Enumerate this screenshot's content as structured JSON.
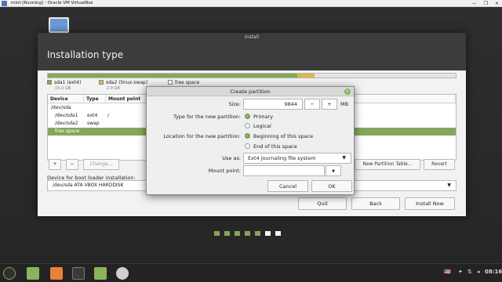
{
  "host_window": {
    "title": "mint [Running] - Oracle VM VirtualBox",
    "controls": [
      "—",
      "❐",
      "✕"
    ]
  },
  "installer": {
    "window_title": "Install",
    "page_title": "Installation type",
    "legend": [
      {
        "name": "sda1 (ext4)",
        "size": "15.0 GB",
        "color": "#85a85b"
      },
      {
        "name": "sda2 (linux-swap)",
        "size": "2.0 GB",
        "color": "#d9b94a"
      },
      {
        "name": "free space",
        "size": "",
        "color": "#ffffff"
      }
    ],
    "table": {
      "headers": [
        "Device",
        "Type",
        "Mount point"
      ],
      "rows": [
        {
          "device": "/dev/sda",
          "type": "",
          "mount": ""
        },
        {
          "device": "/dev/sda1",
          "type": "ext4",
          "mount": "/"
        },
        {
          "device": "/dev/sda2",
          "type": "swap",
          "mount": ""
        },
        {
          "device": "free space",
          "type": "",
          "mount": ""
        }
      ],
      "selected_index": 3
    },
    "toolbar": {
      "add": "+",
      "remove": "−",
      "change": "Change...",
      "new_table": "New Partition Table...",
      "revert": "Revert"
    },
    "boot_label": "Device for boot loader installation:",
    "boot_value": "/dev/sda   ATA VBOX HARDDISK",
    "buttons": {
      "quit": "Quit",
      "back": "Back",
      "install": "Install Now"
    },
    "progress": {
      "total_steps": 7,
      "completed_steps": 5
    }
  },
  "dialog": {
    "title": "Create partition",
    "size_label": "Size:",
    "size_value": "9844",
    "minus": "−",
    "plus": "+",
    "unit": "MB",
    "type_label": "Type for the new partition:",
    "type_options": [
      "Primary",
      "Logical"
    ],
    "type_selected": "Primary",
    "location_label": "Location for the new partition:",
    "location_options": [
      "Beginning of this space",
      "End of this space"
    ],
    "location_selected": "Beginning of this space",
    "use_as_label": "Use as:",
    "use_as_value": "Ext4 journaling file system",
    "mount_label": "Mount point:",
    "mount_value": "",
    "cancel": "Cancel",
    "ok": "OK"
  },
  "taskbar": {
    "lang": "🇺🇸",
    "time": "08:16"
  }
}
